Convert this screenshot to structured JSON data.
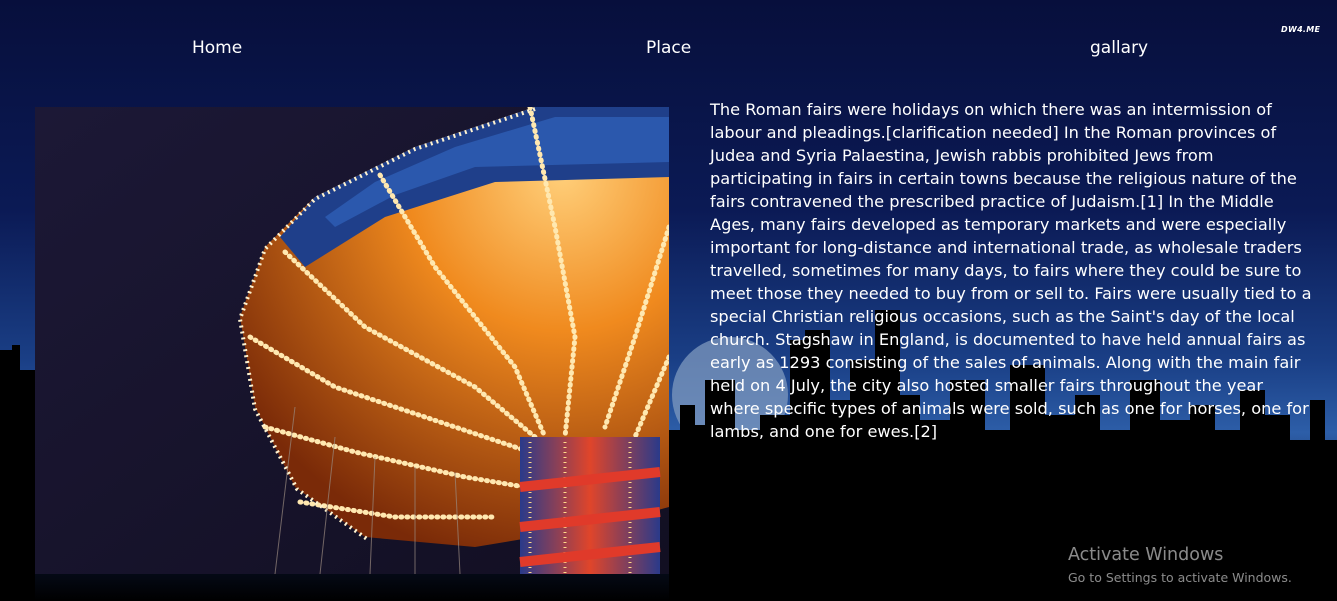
{
  "watermark": "DW4.ME",
  "nav": {
    "home": "Home",
    "place": "Place",
    "gallery": "gallary"
  },
  "article": {
    "text": "The Roman fairs were holidays on which there was an intermission of labour and pleadings.[clarification needed] In the Roman provinces of Judea and Syria Palaestina, Jewish rabbis prohibited Jews from participating in fairs in certain towns because the religious nature of the fairs contravened the prescribed practice of Judaism.[1] In the Middle Ages, many fairs developed as temporary markets and were especially important for long-distance and international trade, as wholesale traders travelled, sometimes for many days, to fairs where they could be sure to meet those they needed to buy from or sell to. Fairs were usually tied to a special Christian religious occasions, such as the Saint's day of the local church. Stagshaw in England, is documented to have held annual fairs as early as 1293 consisting of the sales of animals. Along with the main fair held on 4 July, the city also hosted smaller fairs throughout the year where specific types of animals were sold, such as one for horses, one for lambs, and one for ewes.[2]"
  },
  "activation": {
    "title": "Activate Windows",
    "subtitle": "Go to Settings to activate Windows."
  },
  "colors": {
    "background_top": "#070f3c",
    "background_mid": "#2d5ea8",
    "ride_orange": "#e07a1c",
    "ride_lights": "#ffe8b0"
  }
}
